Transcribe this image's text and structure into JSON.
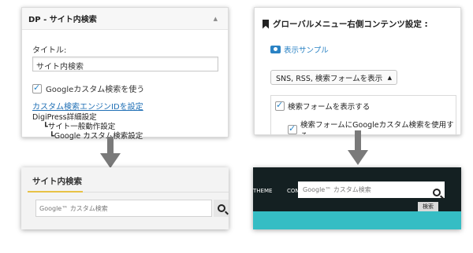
{
  "widget_panel": {
    "title": "DP - サイト内検索",
    "collapse_icon": "triangle-up-icon",
    "title_label": "タイトル:",
    "title_value": "サイト内検索",
    "checkbox_label": "Googleカスタム検索を使う",
    "checkbox_checked": true,
    "link_text": "カスタム検索エンジンIDを設定",
    "tree": [
      "DigiPress詳細設定",
      "┗サイト一般動作設定",
      "┗Google カスタム検索設定"
    ]
  },
  "settings_panel": {
    "title": "グローバルメニュー右側コンテンツ設定 :",
    "sample_link": "表示サンプル",
    "select_value": "SNS, RSS, 検索フォームを表示",
    "option_show_search": "検索フォームを表示する",
    "option_show_search_checked": true,
    "option_use_google": "検索フォームにGoogleカスタム検索を使用する",
    "option_use_google_checked": true
  },
  "result_widget": {
    "title": "サイト内検索",
    "search_placeholder": "Google™ カスタム検索",
    "accent_color": "#e8c245"
  },
  "result_header": {
    "nav_item_1": "THEME",
    "nav_item_2": "CON",
    "search_placeholder": "Google™ カスタム検索",
    "search_button": "検索",
    "accent_color": "#35bdc4"
  }
}
